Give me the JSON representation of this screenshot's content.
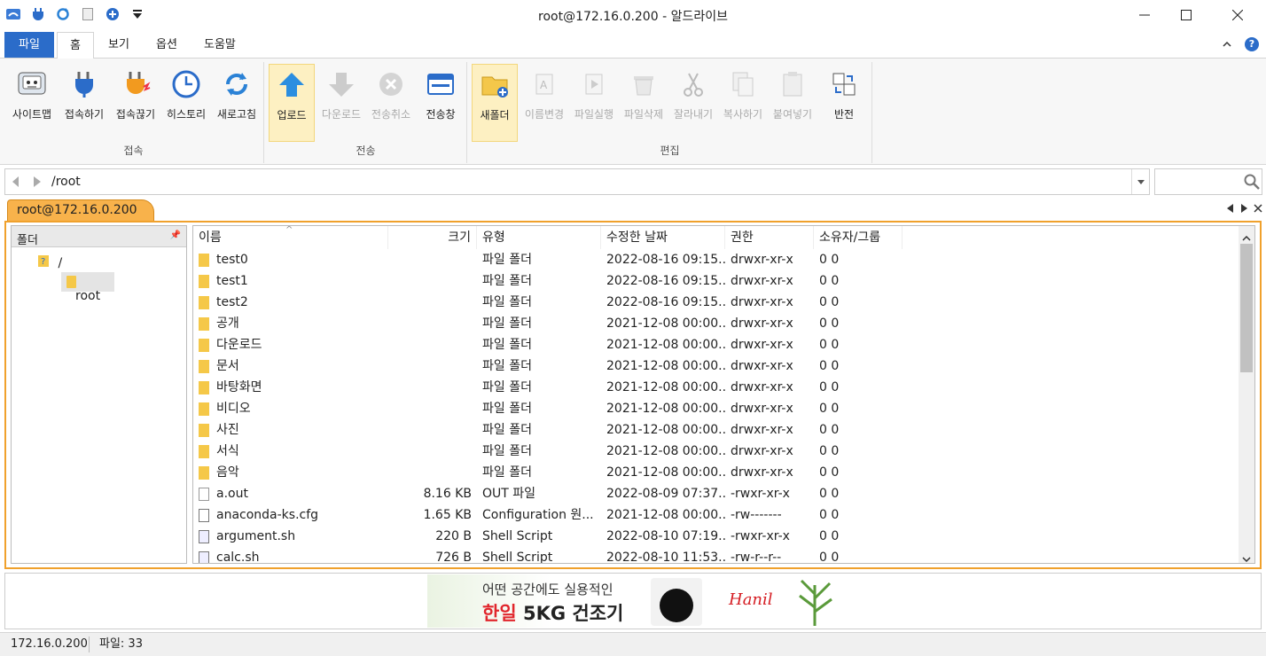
{
  "window": {
    "title": "root@172.16.0.200 - 알드라이브"
  },
  "tabs": [
    {
      "label": "파일"
    },
    {
      "label": "홈"
    },
    {
      "label": "보기"
    },
    {
      "label": "옵션"
    },
    {
      "label": "도움말"
    }
  ],
  "ribbon": {
    "connect_group": "접속",
    "connect": [
      "사이트맵",
      "접속하기",
      "접속끊기",
      "히스토리",
      "새로고침"
    ],
    "transfer_group": "전송",
    "transfer": [
      "업로드",
      "다운로드",
      "전송취소",
      "전송창"
    ],
    "edit_group": "편집",
    "edit": [
      "새폴더",
      "이름변경",
      "파일실행",
      "파일삭제",
      "잘라내기",
      "복사하기",
      "붙여넣기",
      "반전"
    ]
  },
  "address": {
    "path": "/root"
  },
  "session": {
    "tab": "root@172.16.0.200"
  },
  "tree": {
    "header": "폴더",
    "root": "/",
    "child": "root"
  },
  "columns": [
    "이름",
    "크기",
    "유형",
    "수정한 날짜",
    "권한",
    "소유자/그룹"
  ],
  "files": [
    {
      "name": "test0",
      "size": "",
      "type": "파일 폴더",
      "date": "2022-08-16 09:15...",
      "perm": "drwxr-xr-x",
      "owner": "0 0",
      "kind": "folder"
    },
    {
      "name": "test1",
      "size": "",
      "type": "파일 폴더",
      "date": "2022-08-16 09:15...",
      "perm": "drwxr-xr-x",
      "owner": "0 0",
      "kind": "folder"
    },
    {
      "name": "test2",
      "size": "",
      "type": "파일 폴더",
      "date": "2022-08-16 09:15...",
      "perm": "drwxr-xr-x",
      "owner": "0 0",
      "kind": "folder"
    },
    {
      "name": "공개",
      "size": "",
      "type": "파일 폴더",
      "date": "2021-12-08 00:00...",
      "perm": "drwxr-xr-x",
      "owner": "0 0",
      "kind": "folder"
    },
    {
      "name": "다운로드",
      "size": "",
      "type": "파일 폴더",
      "date": "2021-12-08 00:00...",
      "perm": "drwxr-xr-x",
      "owner": "0 0",
      "kind": "folder"
    },
    {
      "name": "문서",
      "size": "",
      "type": "파일 폴더",
      "date": "2021-12-08 00:00...",
      "perm": "drwxr-xr-x",
      "owner": "0 0",
      "kind": "folder"
    },
    {
      "name": "바탕화면",
      "size": "",
      "type": "파일 폴더",
      "date": "2021-12-08 00:00...",
      "perm": "drwxr-xr-x",
      "owner": "0 0",
      "kind": "folder"
    },
    {
      "name": "비디오",
      "size": "",
      "type": "파일 폴더",
      "date": "2021-12-08 00:00...",
      "perm": "drwxr-xr-x",
      "owner": "0 0",
      "kind": "folder"
    },
    {
      "name": "사진",
      "size": "",
      "type": "파일 폴더",
      "date": "2021-12-08 00:00...",
      "perm": "drwxr-xr-x",
      "owner": "0 0",
      "kind": "folder"
    },
    {
      "name": "서식",
      "size": "",
      "type": "파일 폴더",
      "date": "2021-12-08 00:00...",
      "perm": "drwxr-xr-x",
      "owner": "0 0",
      "kind": "folder"
    },
    {
      "name": "음악",
      "size": "",
      "type": "파일 폴더",
      "date": "2021-12-08 00:00...",
      "perm": "drwxr-xr-x",
      "owner": "0 0",
      "kind": "folder"
    },
    {
      "name": "a.out",
      "size": "8.16 KB",
      "type": "OUT 파일",
      "date": "2022-08-09 07:37...",
      "perm": "-rwxr-xr-x",
      "owner": "0 0",
      "kind": "file"
    },
    {
      "name": "anaconda-ks.cfg",
      "size": "1.65 KB",
      "type": "Configuration 원...",
      "date": "2021-12-08 00:00...",
      "perm": "-rw-------",
      "owner": "0 0",
      "kind": "cfg"
    },
    {
      "name": "argument.sh",
      "size": "220 B",
      "type": "Shell Script",
      "date": "2022-08-10 07:19...",
      "perm": "-rwxr-xr-x",
      "owner": "0 0",
      "kind": "script"
    },
    {
      "name": "calc.sh",
      "size": "726 B",
      "type": "Shell Script",
      "date": "2022-08-10 11:53...",
      "perm": "-rw-r--r--",
      "owner": "0 0",
      "kind": "script"
    }
  ],
  "ad": {
    "line1": "어떤 공간에도 실용적인",
    "line2_red": "한일",
    "line2": "5KG 건조기",
    "brand": "Hanil"
  },
  "status": {
    "host": "172.16.0.200",
    "count": "파일: 33"
  }
}
